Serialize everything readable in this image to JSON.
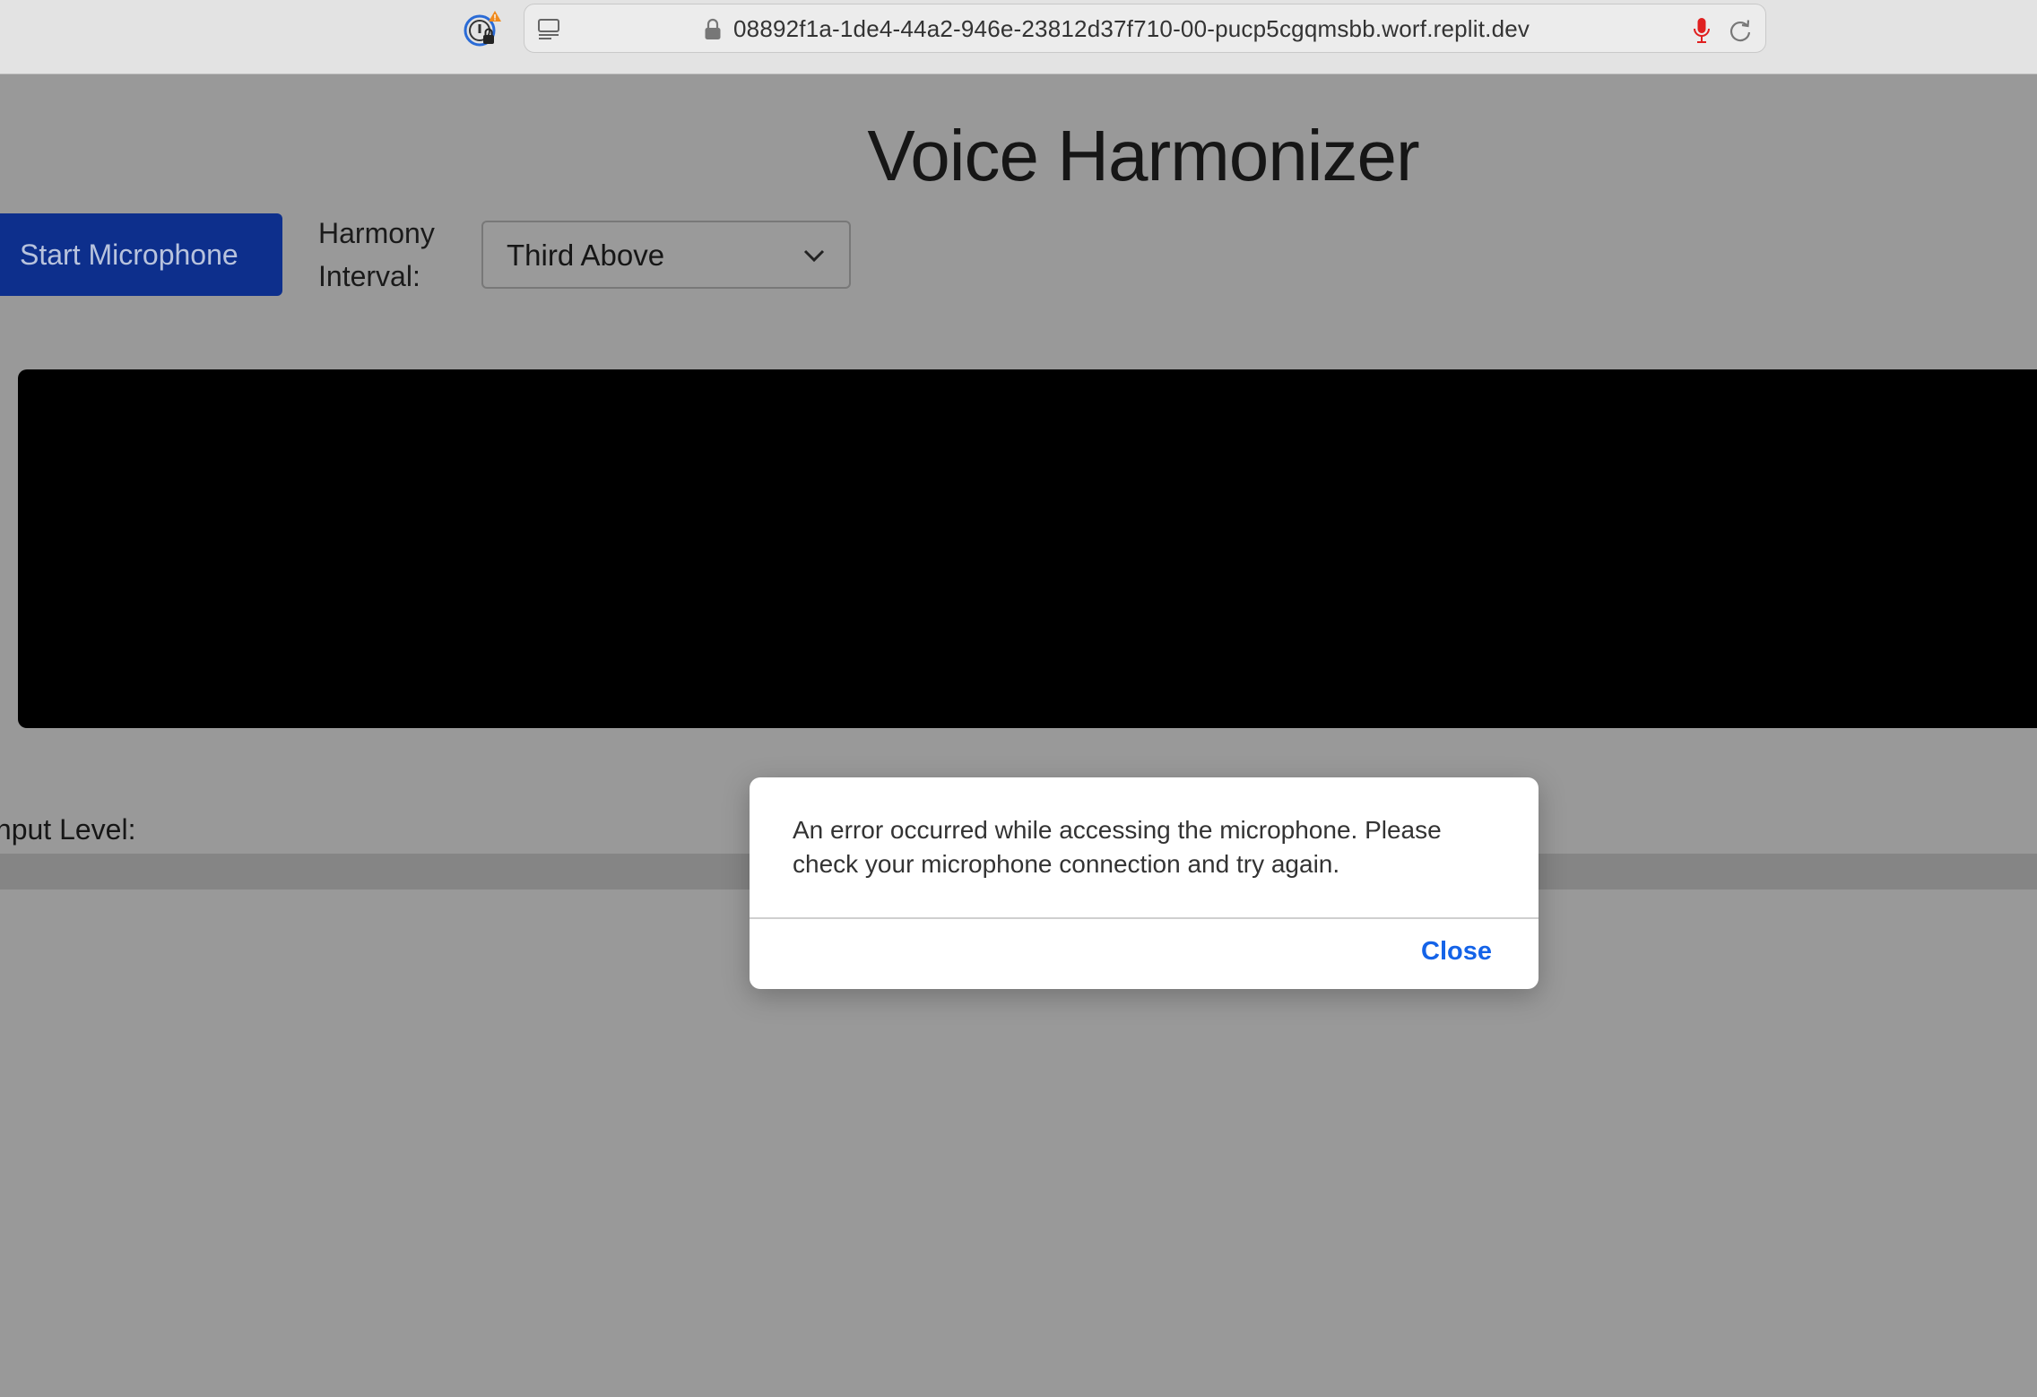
{
  "browser": {
    "url": "08892f1a-1de4-44a2-946e-23812d37f710-00-pucp5cgqmsbb.worf.replit.dev",
    "icons": [
      "password-manager-icon",
      "sidebar-icon",
      "lock-icon",
      "microphone-icon",
      "reload-icon"
    ]
  },
  "page": {
    "title": "Voice Harmonizer",
    "start_button_label": "Start Microphone",
    "interval_label": "Harmony Interval:",
    "interval_selected": "Third Above",
    "input_level_label": "Input Level:",
    "input_level": 0
  },
  "dialog": {
    "message": "An error occurred while accessing the microphone. Please check your microphone connection and try again.",
    "close_label": "Close"
  },
  "colors": {
    "overlay_bg": "#999999",
    "primary_button": "#0d2f8c",
    "dialog_link": "#1463e8",
    "mic_indicator": "#e02020"
  }
}
